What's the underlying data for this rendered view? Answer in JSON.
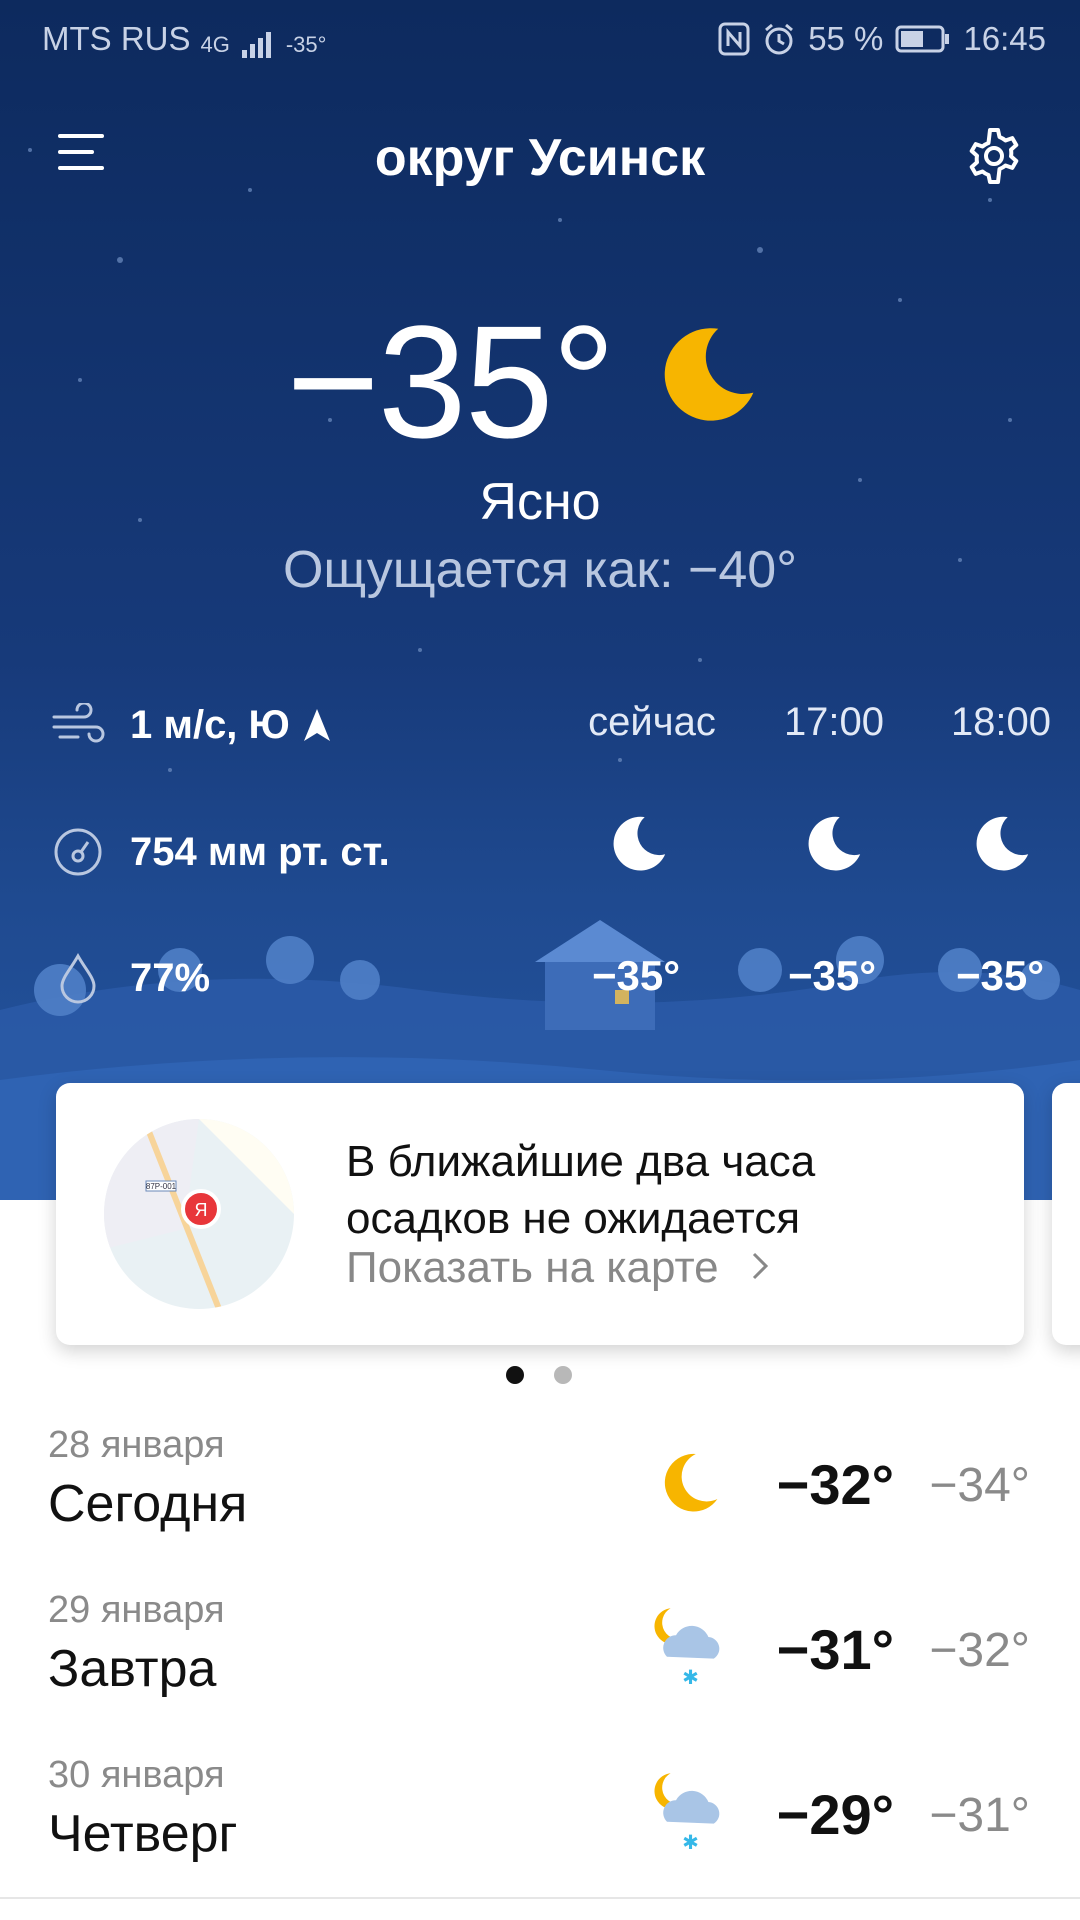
{
  "status_bar": {
    "carrier": "MTS RUS",
    "network": "4G",
    "temp": "-35°",
    "battery": "55 %",
    "time": "16:45"
  },
  "header": {
    "city": "округ Усинск"
  },
  "current": {
    "temperature": "−35°",
    "condition": "Ясно",
    "feels_like": "Ощущается как: −40°",
    "wind": "1 м/с, Ю",
    "pressure": "754 мм рт. ст.",
    "humidity": "77%"
  },
  "hourly": [
    {
      "time": "сейчас",
      "temp": "−35°",
      "icon": "moon-icon"
    },
    {
      "time": "17:00",
      "temp": "−35°",
      "icon": "moon-icon"
    },
    {
      "time": "18:00",
      "temp": "−35°",
      "icon": "moon-icon"
    }
  ],
  "nowcast_card": {
    "message": "В ближайшие два часа осадков не ожидается",
    "link": "Показать на карте",
    "map_logo": "Я",
    "map_road_label": "87P-001"
  },
  "pager": {
    "count": 2,
    "active": 0
  },
  "days": [
    {
      "date": "28 января",
      "name": "Сегодня",
      "hi": "−32°",
      "lo": "−34°",
      "icon": "moon-icon"
    },
    {
      "date": "29 января",
      "name": "Завтра",
      "hi": "−31°",
      "lo": "−32°",
      "icon": "moon-cloud-snow-icon"
    },
    {
      "date": "30 января",
      "name": "Четверг",
      "hi": "−29°",
      "lo": "−31°",
      "icon": "moon-cloud-snow-icon"
    }
  ],
  "colors": {
    "hero_top": "#0d2a5e",
    "hero_bottom": "#2455a0",
    "moon": "#f7b500",
    "snowflake": "#35b8e8"
  }
}
